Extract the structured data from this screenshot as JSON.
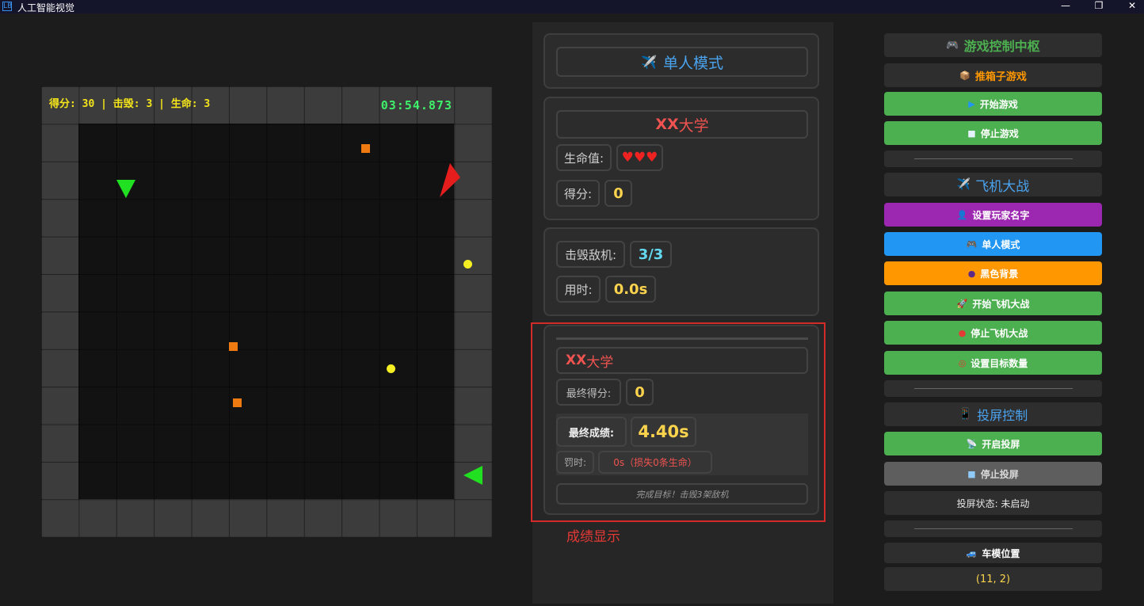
{
  "window": {
    "title": "人工智能视觉",
    "app_icon": "LB",
    "minimize": "—",
    "restore": "❐",
    "close": "✕"
  },
  "game": {
    "hud": "得分: 30 | 击毁: 3 | 生命: 3",
    "timer": "03:54.873",
    "colors": {
      "wall": "#3c3c3c",
      "floor": "#121212",
      "box": "#f07a12",
      "coin": "#f5ee22",
      "enemy": "#21e021",
      "player": "#e51d1d"
    }
  },
  "middle": {
    "mode_icon": "✈️",
    "mode": "单人模式",
    "player_card": {
      "name_prefix": "XX",
      "name_suffix": "大学",
      "life_label": "生命值:",
      "life_value": "♥♥♥",
      "score_label": "得分:",
      "score_value": "0"
    },
    "stats": {
      "kills_label": "击毁敌机:",
      "kills_value": "3/3",
      "time_label": "用时:",
      "time_value": "0.0s"
    },
    "result": {
      "name_prefix": "XX",
      "name_suffix": "大学",
      "final_score_label": "最终得分:",
      "final_score_value": "0",
      "final_result_label": "最终成绩:",
      "final_result_value": "4.40s",
      "penalty_label": "罚时:",
      "penalty_value": "0s（损失0条生命）",
      "note": "完成目标！击毁3架敌机"
    },
    "annotation": "成绩显示"
  },
  "panel": {
    "control_center": {
      "icon": "🎮",
      "label": "游戏控制中枢"
    },
    "sokoban": {
      "icon": "📦",
      "label": "推箱子游戏"
    },
    "start_game": {
      "icon": "▶",
      "label": "开始游戏"
    },
    "stop_game": {
      "icon": "■",
      "label": "停止游戏"
    },
    "plane_war": {
      "icon": "✈️",
      "label": "飞机大战"
    },
    "set_name": {
      "icon": "👤",
      "label": "设置玩家名字"
    },
    "single_mode": {
      "icon": "🎮",
      "label": "单人模式"
    },
    "black_bg": {
      "icon": "●",
      "label": "黑色背景"
    },
    "start_plane": {
      "icon": "🚀",
      "label": "开始飞机大战"
    },
    "stop_plane": {
      "icon": "●",
      "label": "停止飞机大战"
    },
    "set_target": {
      "icon": "◎",
      "label": "设置目标数量"
    },
    "screen_control": {
      "icon": "📱",
      "label": "投屏控制"
    },
    "start_cast": {
      "icon": "📡",
      "label": "开启投屏"
    },
    "stop_cast": {
      "icon": "■",
      "label": "停止投屏"
    },
    "cast_status": "投屏状态: 未启动",
    "car_pos": {
      "icon": "🚙",
      "label": "车模位置"
    },
    "car_value": "(11, 2)"
  }
}
